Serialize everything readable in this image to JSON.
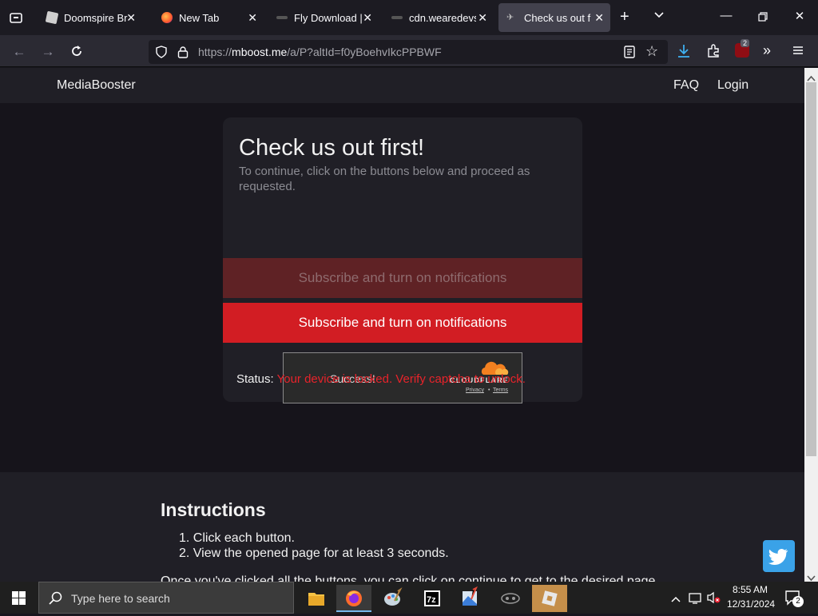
{
  "browser": {
    "tabs": [
      {
        "label": "Doomspire Brick",
        "icon": "roblox-icon"
      },
      {
        "label": "New Tab",
        "icon": "firefox-icon"
      },
      {
        "label": "Fly Download | W",
        "icon": "site-icon"
      },
      {
        "label": "cdn.wearedevs.n",
        "icon": "site-icon"
      },
      {
        "label": "Check us out fir",
        "icon": "site-icon",
        "active": true
      }
    ],
    "url_prefix": "https://",
    "url_host": "mboost.me",
    "url_path": "/a/P?altId=f0yBoehvIkcPPBWF",
    "extension_badge": "2"
  },
  "site": {
    "brand": "MediaBooster",
    "nav": {
      "faq": "FAQ",
      "login": "Login"
    },
    "card": {
      "title": "Check us out first!",
      "subtitle": "To continue, click on the buttons below and proceed as requested.",
      "button1": "Subscribe and turn on notifications",
      "button2": "Subscribe and turn on notifications"
    },
    "captcha": {
      "message": "Success!",
      "brand": "CLOUDFLARE",
      "privacy": "Privacy",
      "separator": "•",
      "terms": "Terms"
    },
    "status": {
      "label": "Status:",
      "value": "Your device is locked. Verify captcha to unlock."
    },
    "instructions": {
      "title": "Instructions",
      "steps": [
        "Click each button.",
        "View the opened page for at least 3 seconds."
      ],
      "cutoff": "Once you've clicked all the buttons, you can click on continue to get to the desired page."
    }
  },
  "taskbar": {
    "search_placeholder": "Type here to search",
    "time": "8:55 AM",
    "date": "12/31/2024",
    "notification_count": "2"
  },
  "colors": {
    "accent_red": "#d21d23",
    "status_red": "#e8232a",
    "cloudflare_orange": "#f38020",
    "twitter_blue": "#3aa2e8"
  }
}
